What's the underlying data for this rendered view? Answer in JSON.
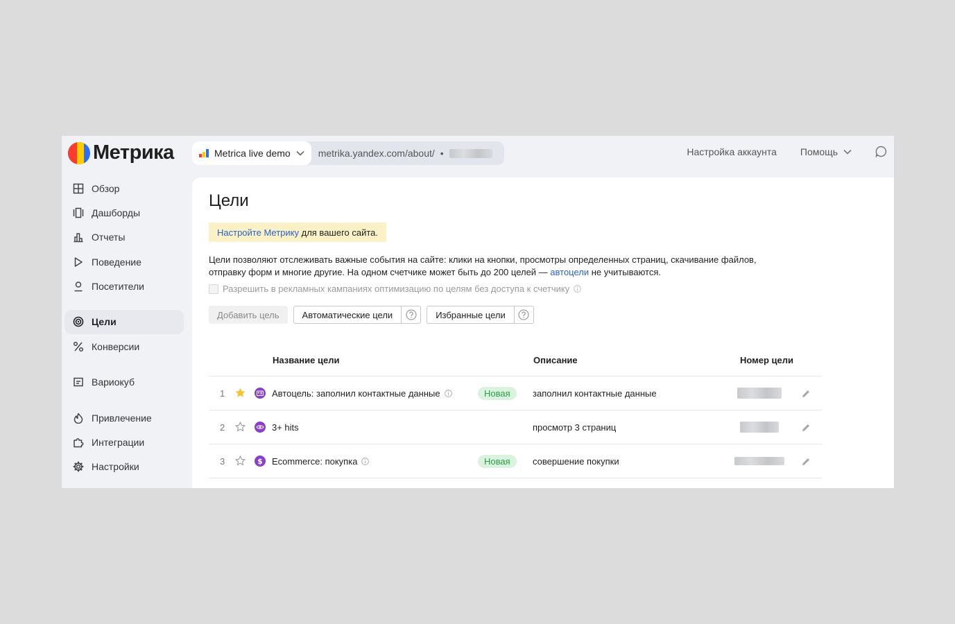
{
  "header": {
    "logo_text": "Метрика",
    "counter_name": "Metrica live demo",
    "counter_url": "metrika.yandex.com/about/",
    "separator": "•",
    "account_settings": "Настройка аккаунта",
    "help": "Помощь"
  },
  "sidebar": {
    "items": [
      {
        "label": "Обзор"
      },
      {
        "label": "Дашборды"
      },
      {
        "label": "Отчеты"
      },
      {
        "label": "Поведение"
      },
      {
        "label": "Посетители"
      },
      {
        "label": "Цели"
      },
      {
        "label": "Конверсии"
      },
      {
        "label": "Вариокуб"
      },
      {
        "label": "Привлечение"
      },
      {
        "label": "Интеграции"
      },
      {
        "label": "Настройки"
      }
    ],
    "active_index": 5
  },
  "main": {
    "title": "Цели",
    "banner_link": "Настройте Метрику",
    "banner_text": " для вашего сайта.",
    "description_part1": "Цели позволяют отслеживать важные события на сайте: клики на кнопки, просмотры определенных страниц, скачивание файлов, отправку форм и многие другие. На одном счетчике может быть до 200 целей — ",
    "description_link": "автоцели",
    "description_part2": " не учитываются.",
    "checkbox_label": "Разрешить в рекламных кампаниях оптимизацию по целям без доступа к счетчику",
    "buttons": {
      "add_goal": "Добавить цель",
      "auto_goals": "Автоматические цели",
      "favorite_goals": "Избранные цели"
    },
    "table": {
      "headers": {
        "name": "Название цели",
        "description": "Описание",
        "number": "Номер цели"
      },
      "rows": [
        {
          "num": "1",
          "favorite": true,
          "icon": "contacts-icon",
          "name": "Автоцель: заполнил контактные данные",
          "info": true,
          "badge": "Новая",
          "description": "заполнил контактные данные"
        },
        {
          "num": "2",
          "favorite": false,
          "icon": "eye-icon",
          "name": "3+ hits",
          "info": false,
          "badge": "",
          "description": "просмотр 3 страниц"
        },
        {
          "num": "3",
          "favorite": false,
          "icon": "dollar-icon",
          "name": "Ecommerce: покупка",
          "info": true,
          "badge": "Новая",
          "description": "совершение покупки"
        }
      ]
    }
  },
  "colors": {
    "accent_link": "#2d62c6",
    "banner_bg": "#fbf1c6",
    "badge_bg": "#d9f3df",
    "badge_text": "#2f9a49",
    "star_active": "#f7c431",
    "goal_icon": "#8a3fc7"
  }
}
